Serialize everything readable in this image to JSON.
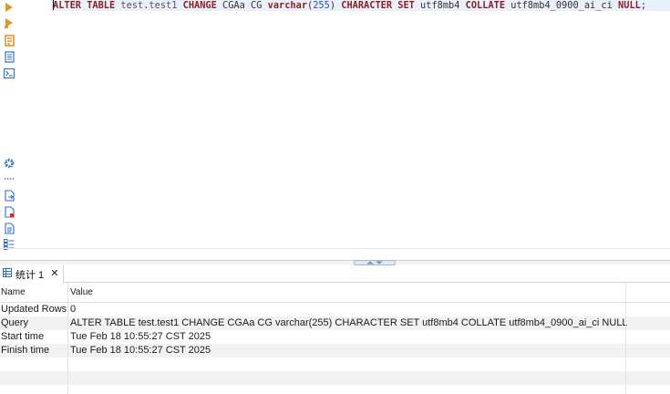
{
  "editor": {
    "sql_tokens": [
      {
        "text": "ALTER TABLE",
        "kind": "kw"
      },
      {
        "text": " ",
        "kind": "plain"
      },
      {
        "text": "test",
        "kind": "id"
      },
      {
        "text": ".",
        "kind": "plain"
      },
      {
        "text": "test1",
        "kind": "id"
      },
      {
        "text": " ",
        "kind": "plain"
      },
      {
        "text": "CHANGE",
        "kind": "kw"
      },
      {
        "text": " CGAa CG ",
        "kind": "plain"
      },
      {
        "text": "varchar",
        "kind": "kw"
      },
      {
        "text": "(",
        "kind": "plain"
      },
      {
        "text": "255",
        "kind": "num"
      },
      {
        "text": ") ",
        "kind": "plain"
      },
      {
        "text": "CHARACTER SET",
        "kind": "kw"
      },
      {
        "text": " utf8mb4 ",
        "kind": "plain"
      },
      {
        "text": "COLLATE",
        "kind": "kw"
      },
      {
        "text": " utf8mb4_0900_ai_ci ",
        "kind": "plain"
      },
      {
        "text": "NULL",
        "kind": "kw"
      },
      {
        "text": ";",
        "kind": "plain"
      }
    ]
  },
  "toolbar": {
    "icons": [
      "run-statement-icon",
      "run-script-icon",
      "explain-plan-icon",
      "load-script-icon",
      "console-icon",
      "settings-icon",
      "more-dots-icon",
      "export-icon",
      "delete-file-icon",
      "format-icon",
      "outline-icon"
    ]
  },
  "results": {
    "tab_label": "统计 1",
    "tab_close": "✕",
    "columns": [
      "Name",
      "Value"
    ],
    "rows": [
      {
        "name": "Updated Rows",
        "value": "0"
      },
      {
        "name": "Query",
        "value": "ALTER TABLE test.test1 CHANGE CGAa CG varchar(255) CHARACTER SET utf8mb4 COLLATE utf8mb4_0900_ai_ci NULL"
      },
      {
        "name": "Start time",
        "value": "Tue Feb 18 10:55:27 CST 2025"
      },
      {
        "name": "Finish time",
        "value": "Tue Feb 18 10:55:27 CST 2025"
      },
      {
        "name": "",
        "value": ""
      },
      {
        "name": "",
        "value": ""
      }
    ]
  },
  "colors": {
    "keyword": "#8b1e1e",
    "number": "#2b4fbf",
    "toolbar_orange": "#e8922b",
    "toolbar_blue": "#2e6fc7",
    "current_line": "#e9f0fb"
  }
}
